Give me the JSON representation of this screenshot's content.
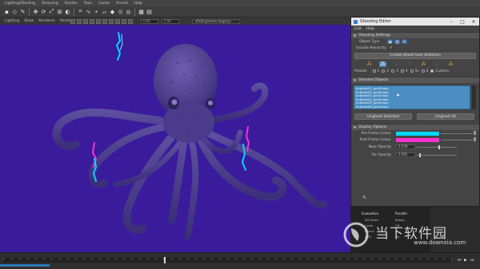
{
  "menubar": {
    "items": [
      "Lighting/Shading",
      "Texturing",
      "Render",
      "Toon",
      "Cache",
      "Arnold",
      "Help"
    ]
  },
  "viewport_menu": {
    "items": [
      "Lighting",
      "Show",
      "Renderer",
      "Panels"
    ],
    "near_clip": "0.00",
    "far_clip": "1.00",
    "camera": "sRGB gamma (legacy)"
  },
  "editor": {
    "title": "Ghosting Editor",
    "menu": [
      "Edit",
      "Help"
    ],
    "sections": {
      "settings": "Ghosting Settings",
      "objects": "Ghosted Objects",
      "display": "Display Options"
    },
    "object_type_label": "Object Type",
    "include_hierarchy_label": "Include Hierarchy",
    "create_button": "Create Ghost from Selection",
    "presets_label": "Presets",
    "preset_radios": [
      "1",
      "2",
      "3",
      "4",
      "5s",
      "6",
      "Custom"
    ],
    "selected_preset": "Custom",
    "ghosted_items": [
      "bubbles01_geoShape",
      "bubbles02_geoShape",
      "bubbles03_geoShape",
      "bubbles04_geoShape",
      "bubbles05_geoShape",
      "bubbles06_geoShape"
    ],
    "unghost_selected": "Unghost Selected",
    "unghost_all": "Unghost All",
    "pre_frame_label": "Pre-Frame Colour",
    "post_frame_label": "Post-Frame Colour",
    "near_opacity_label": "Near Opacity",
    "near_opacity": "0.539",
    "far_opacity_label": "Far Opacity",
    "far_opacity": "0.065",
    "colors": {
      "pre_frame": "#00d7ff",
      "post_frame": "#ff2fd2"
    }
  },
  "eval_panel": {
    "header": "Evaluation",
    "value": "Parallel",
    "rows": [
      {
        "k": "EM State",
        "v": "Ready"
      },
      {
        "k": "Cycle",
        "v": "Off"
      },
      {
        "k": "Count",
        "v": "1"
      },
      {
        "k": "GPU",
        "v": "On"
      }
    ]
  },
  "watermark": {
    "text_cn": "当下软件园",
    "url": "www.downxia.com"
  },
  "timeline": {
    "progress": 0.11
  },
  "scene_colors": {
    "background": "#3a1b9c",
    "octopus": "#4e3f8f"
  }
}
